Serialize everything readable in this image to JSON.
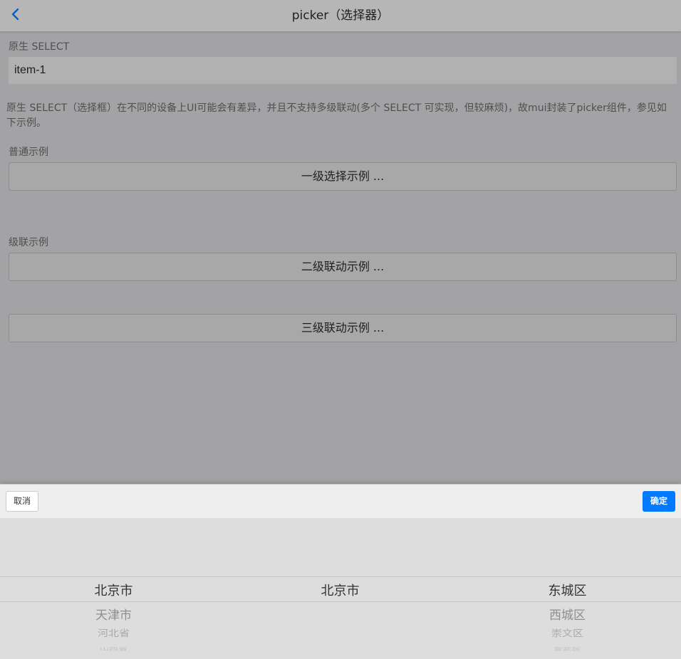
{
  "navbar": {
    "title": "picker（选择器）",
    "back_icon": "chevron-left-icon",
    "accent": "#007aff"
  },
  "native_select": {
    "label": "原生 SELECT",
    "value": "item-1"
  },
  "description": "原生 SELECT（选择框）在不同的设备上UI可能会有差异，并且不支持多级联动(多个 SELECT 可实现，但较麻烦)，故mui封装了picker组件，参见如下示例。",
  "normal_section": {
    "label": "普通示例",
    "button": "一级选择示例 ..."
  },
  "cascade_section": {
    "label": "级联示例",
    "button_2": "二级联动示例 ...",
    "button_3": "三级联动示例 ..."
  },
  "picker": {
    "cancel_label": "取消",
    "ok_label": "确定",
    "ok_color": "#007aff",
    "col1": [
      "北京市",
      "天津市",
      "河北省",
      "山西省"
    ],
    "col2": [
      "北京市"
    ],
    "col3": [
      "东城区",
      "西城区",
      "崇文区",
      "宣武区"
    ]
  }
}
